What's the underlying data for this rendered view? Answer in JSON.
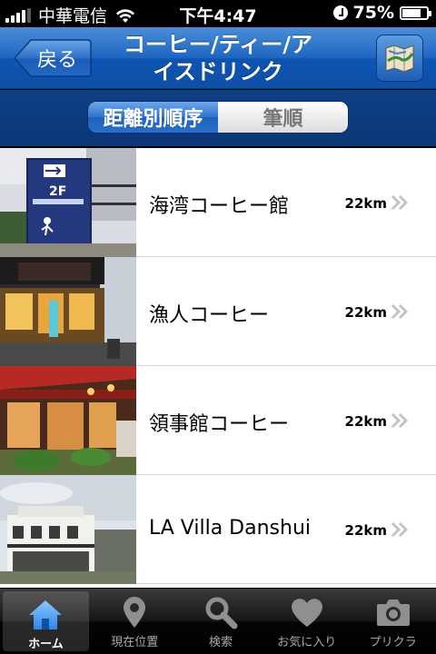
{
  "status": {
    "carrier": "中華電信",
    "time": "下午4:47",
    "battery": "75%",
    "battery_level": 0.75
  },
  "nav": {
    "back_label": "戻る",
    "title_line1": "コーヒー/ティー/ア",
    "title_line2": "イスドリンク",
    "map_icon": "map-icon"
  },
  "segment": {
    "options": [
      "距離別順序",
      "筆順"
    ],
    "selected": "距離別順序"
  },
  "list": [
    {
      "name": "海湾コーヒー館",
      "distance": "22km",
      "thumb_sign": "2F"
    },
    {
      "name": "漁人コーヒー",
      "distance": "22km"
    },
    {
      "name": "領事館コーヒー",
      "distance": "22km"
    },
    {
      "name": "LA Villa Danshui",
      "distance": "22km"
    }
  ],
  "tabs": [
    {
      "label": "ホーム",
      "icon": "home-icon",
      "active": true
    },
    {
      "label": "現在位置",
      "icon": "location-pin-icon",
      "active": false
    },
    {
      "label": "検索",
      "icon": "search-icon",
      "active": false
    },
    {
      "label": "お気に入り",
      "icon": "heart-icon",
      "active": false
    },
    {
      "label": "プリクラ",
      "icon": "camera-icon",
      "active": false
    }
  ],
  "colors": {
    "nav_blue": "#1f66c2",
    "segment_active": "#2f73cc",
    "tab_bar": "#000000"
  }
}
